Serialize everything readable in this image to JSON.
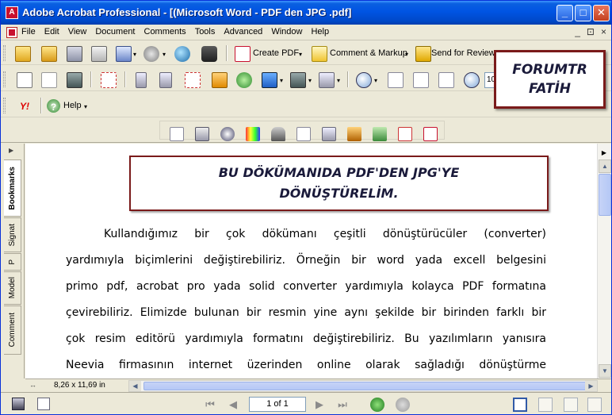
{
  "window": {
    "title": "Adobe Acrobat Professional - [(Microsoft Word - PDF den JPG .pdf]",
    "minimize_glyph": "_",
    "maximize_glyph": "□",
    "close_glyph": "✕"
  },
  "menu": {
    "items": [
      "File",
      "Edit",
      "View",
      "Document",
      "Comments",
      "Tools",
      "Advanced",
      "Window",
      "Help"
    ],
    "doc_controls": [
      "_",
      "⊡",
      "×"
    ]
  },
  "toolbar": {
    "create_pdf_label": "Create PDF",
    "comment_markup_label": "Comment & Markup",
    "send_review_label": "Send for Review",
    "zoom_value": "10",
    "yahoo_label": "Y!",
    "help_label": "Help",
    "help_glyph": "?"
  },
  "stamp": {
    "line1": "FORUMTR",
    "line2": "FATİH"
  },
  "nav_tabs": [
    "Bookmarks",
    "Signat",
    "P",
    "Model",
    "Comment"
  ],
  "document": {
    "heading_line1": "BU DÖKÜMANIDA PDF'DEN JPG'YE",
    "heading_line2": "DÖNÜŞTÜRELİM.",
    "lines": [
      "Kullandığımız bir çok dökümanı çeşitli dönüştürücüler (converter)",
      "yardımıyla biçimlerini değiştirebiliriz. Örneğin bir word yada excell belgesini",
      "primo pdf, acrobat pro yada solid converter yardımıyla kolayca PDF formatına",
      "çevirebiliriz. Elimizde bulunan bir resmin yine aynı şekilde bir birinden farklı bir",
      "çok resim editörü yardımıyla formatını değiştirebiliriz. Bu yazılımların yanısıra",
      "Neevia firmasının internet üzerinden online olarak sağladığı dönüştürme"
    ]
  },
  "status": {
    "page_size": "8,26 x 11,69 in",
    "page_indicator": "1 of 1"
  },
  "icons": {
    "first_page": "⏮",
    "prev_page": "◀",
    "next_page": "▶",
    "last_page": "⏭",
    "scroll_up": "▲",
    "scroll_down": "▼",
    "scroll_left": "◀",
    "scroll_right": "▶",
    "dropdown": "▾",
    "nav_arrow": "▶"
  }
}
